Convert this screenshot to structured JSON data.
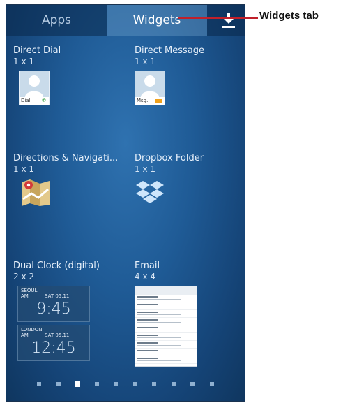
{
  "tabs": [
    {
      "label": "Apps"
    },
    {
      "label": "Widgets"
    }
  ],
  "widgets": [
    {
      "name": "Direct Dial",
      "size": "1 x 1",
      "tile_label": "Dial"
    },
    {
      "name": "Direct Message",
      "size": "1 x 1",
      "tile_label": "Msg."
    },
    {
      "name": "Directions & Navigati...",
      "size": "1 x 1"
    },
    {
      "name": "Dropbox Folder",
      "size": "1 x 1"
    },
    {
      "name": "Dual Clock (digital)",
      "size": "2 x 2",
      "clocks": [
        {
          "city": "SEOUL",
          "ampm": "AM",
          "date": "SAT 05.11",
          "time": "9:45"
        },
        {
          "city": "LONDON",
          "ampm": "AM",
          "date": "SAT 05.11",
          "time": "12:45"
        }
      ]
    },
    {
      "name": "Email",
      "size": "4 x 4"
    }
  ],
  "page_indicator": {
    "count": 10,
    "active_index": 2
  },
  "callout": {
    "label": "Widgets tab",
    "color": "#c0202a"
  },
  "colors": {
    "screen_bg": "#1f5b96",
    "active_tab": "#ffffff"
  }
}
